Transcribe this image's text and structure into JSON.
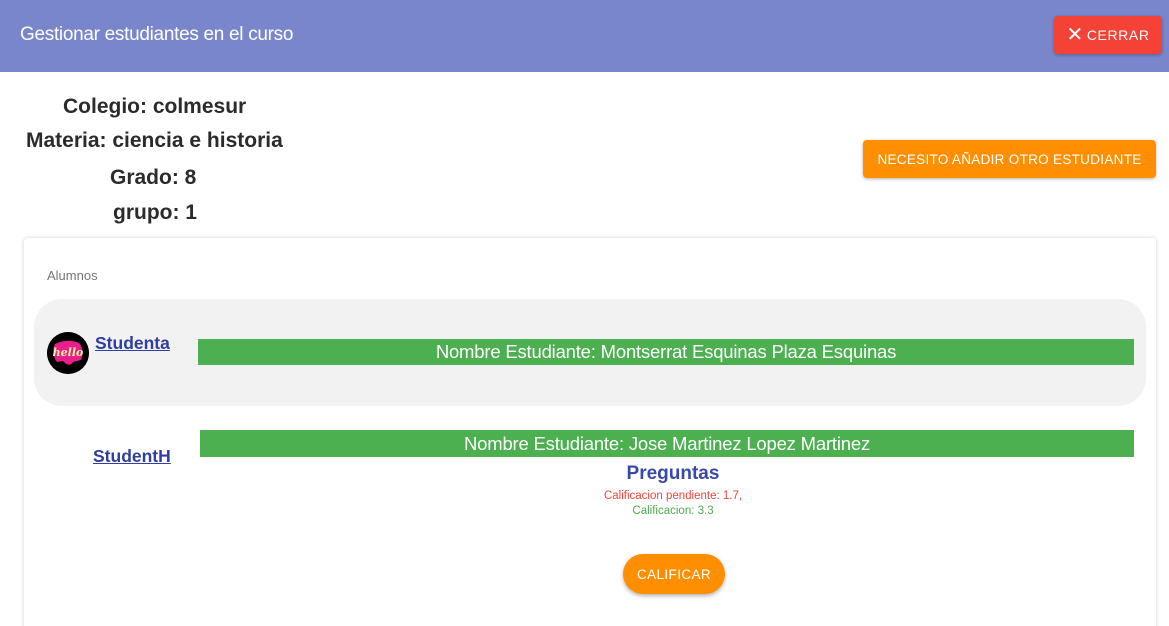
{
  "header": {
    "title": "Gestionar estudiantes en el curso",
    "close_label": "CERRAR",
    "background": "#7986cb"
  },
  "course_info": {
    "school": "Colegio: colmesur",
    "subject": "Materia: ciencia e historia",
    "grade": "Grado: 8",
    "group": "grupo: 1"
  },
  "add_student_label": "NECESITO AÑADIR OTRO ESTUDIANTE",
  "students_section": {
    "label": "Alumnos",
    "students": [
      {
        "link": "Studenta",
        "name": "Nombre Estudiante: Montserrat Esquinas Plaza Esquinas",
        "avatar_text": "hello"
      },
      {
        "link": "StudentH",
        "name": "Nombre Estudiante: Jose Martinez Lopez Martinez",
        "questions_title": "Preguntas",
        "pending_grade": "Calificacion pendiente: 1.7,",
        "grade": "Calificacion: 3.3",
        "grade_button": "CALIFICAR"
      }
    ]
  },
  "colors": {
    "close": "#f44336",
    "accent": "#ff8f00",
    "name_bar": "#4caf50",
    "link": "#303f9f"
  }
}
